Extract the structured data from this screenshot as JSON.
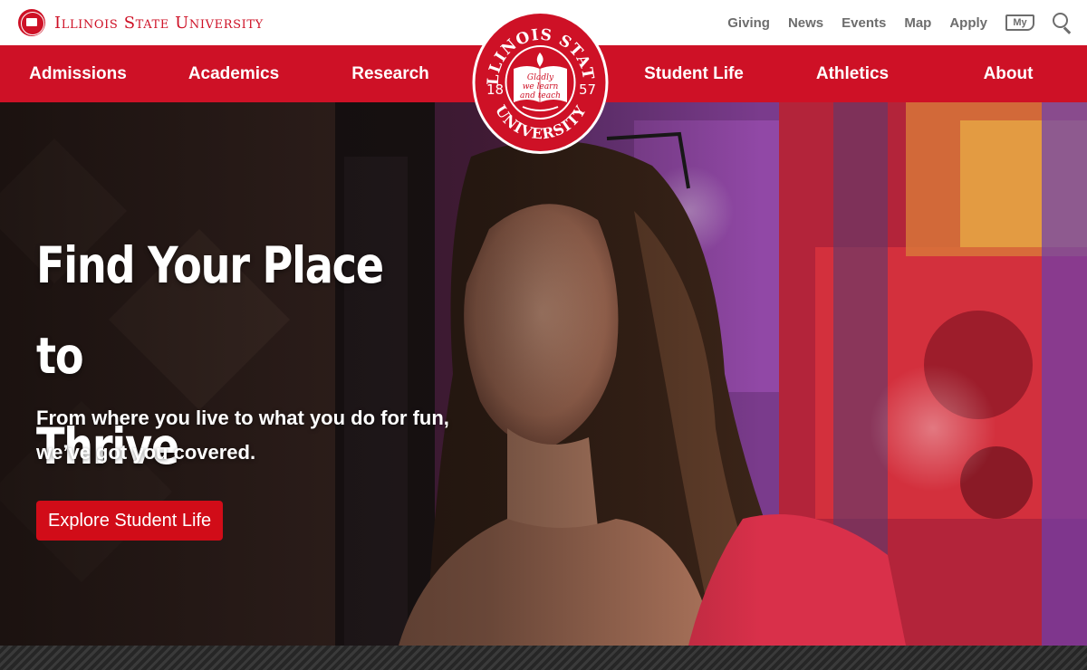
{
  "brand": {
    "name": "Illinois State University"
  },
  "utility_nav": {
    "links": [
      "Giving",
      "News",
      "Events",
      "Map",
      "Apply"
    ],
    "my_label": "My",
    "search_icon": "search-icon"
  },
  "main_nav": {
    "left": [
      "Admissions",
      "Academics",
      "Research"
    ],
    "right": [
      "Student Life",
      "Athletics",
      "About"
    ]
  },
  "seal": {
    "top_text": "ILLINOIS STATE",
    "bottom_text": "UNIVERSITY",
    "year_left": "18",
    "year_right": "57",
    "motto_1": "Gladly",
    "motto_2": "we learn",
    "motto_3": "and teach"
  },
  "hero": {
    "title_line1": "Find Your Place to",
    "title_line2": "Thrive",
    "subtitle_line1": "From where you live to what you do for fun,",
    "subtitle_line2": "we’ve got you covered.",
    "cta_label": "Explore Student Life"
  },
  "colors": {
    "brand_red": "#ce1126",
    "cta_red": "#d10c18",
    "utility_gray": "#6d6d6d",
    "stripe_dark": "#262626"
  }
}
